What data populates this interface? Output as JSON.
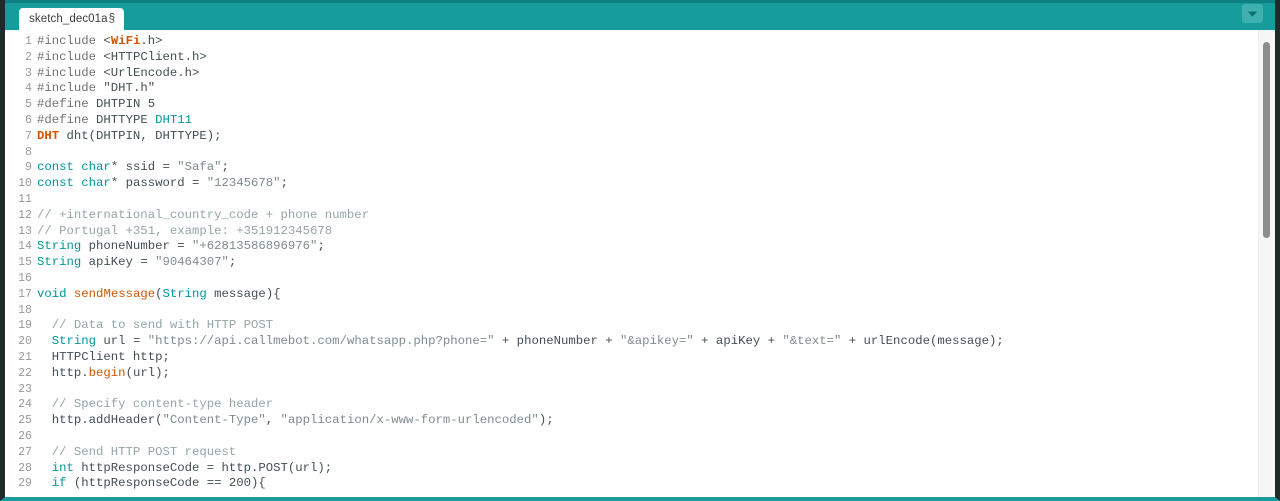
{
  "window": {
    "frame_color": "#1f2b2b",
    "accent_color": "#179c9c"
  },
  "tab_bar": {
    "tabs": [
      {
        "label": "sketch_dec01a",
        "modified_marker": "§",
        "active": true
      }
    ],
    "dropdown_icon": "chevron-down-icon"
  },
  "editor": {
    "language": "arduino-cpp",
    "scrollbar": {
      "orientation": "vertical",
      "thumb_top_pct": 2.5,
      "thumb_height_pct": 42
    },
    "lines": [
      {
        "no": "1",
        "tokens": [
          {
            "t": "#include ",
            "c": "t-pre"
          },
          {
            "t": "<",
            "c": "t-plain"
          },
          {
            "t": "WiFi",
            "c": "t-lib"
          },
          {
            "t": ".h>",
            "c": "t-plain"
          }
        ]
      },
      {
        "no": "2",
        "tokens": [
          {
            "t": "#include ",
            "c": "t-pre"
          },
          {
            "t": "<HTTPClient.h>",
            "c": "t-plain"
          }
        ]
      },
      {
        "no": "3",
        "tokens": [
          {
            "t": "#include ",
            "c": "t-pre"
          },
          {
            "t": "<UrlEncode.h>",
            "c": "t-plain"
          }
        ]
      },
      {
        "no": "4",
        "tokens": [
          {
            "t": "#include ",
            "c": "t-pre"
          },
          {
            "t": "\"DHT.h\"",
            "c": "t-plain"
          }
        ]
      },
      {
        "no": "5",
        "tokens": [
          {
            "t": "#define ",
            "c": "t-pre"
          },
          {
            "t": "DHTPIN 5",
            "c": "t-plain"
          }
        ]
      },
      {
        "no": "6",
        "tokens": [
          {
            "t": "#define ",
            "c": "t-pre"
          },
          {
            "t": "DHTTYPE ",
            "c": "t-plain"
          },
          {
            "t": "DHT11",
            "c": "t-const"
          }
        ]
      },
      {
        "no": "7",
        "tokens": [
          {
            "t": "DHT",
            "c": "t-lib"
          },
          {
            "t": " dht(DHTPIN, DHTTYPE);",
            "c": "t-plain"
          }
        ]
      },
      {
        "no": "8",
        "tokens": []
      },
      {
        "no": "9",
        "tokens": [
          {
            "t": "const",
            "c": "t-kw"
          },
          {
            "t": " ",
            "c": "t-plain"
          },
          {
            "t": "char",
            "c": "t-kw"
          },
          {
            "t": "* ssid = ",
            "c": "t-plain"
          },
          {
            "t": "\"Safa\"",
            "c": "t-str"
          },
          {
            "t": ";",
            "c": "t-plain"
          }
        ]
      },
      {
        "no": "10",
        "tokens": [
          {
            "t": "const",
            "c": "t-kw"
          },
          {
            "t": " ",
            "c": "t-plain"
          },
          {
            "t": "char",
            "c": "t-kw"
          },
          {
            "t": "* password = ",
            "c": "t-plain"
          },
          {
            "t": "\"12345678\"",
            "c": "t-str"
          },
          {
            "t": ";",
            "c": "t-plain"
          }
        ]
      },
      {
        "no": "11",
        "tokens": []
      },
      {
        "no": "12",
        "tokens": [
          {
            "t": "// +international_country_code + phone number",
            "c": "t-cmt"
          }
        ]
      },
      {
        "no": "13",
        "tokens": [
          {
            "t": "// Portugal +351, example: +351912345678",
            "c": "t-cmt"
          }
        ]
      },
      {
        "no": "14",
        "tokens": [
          {
            "t": "String",
            "c": "t-kw"
          },
          {
            "t": " phoneNumber = ",
            "c": "t-plain"
          },
          {
            "t": "\"+62813586896976\"",
            "c": "t-str"
          },
          {
            "t": ";",
            "c": "t-plain"
          }
        ]
      },
      {
        "no": "15",
        "tokens": [
          {
            "t": "String",
            "c": "t-kw"
          },
          {
            "t": " apiKey = ",
            "c": "t-plain"
          },
          {
            "t": "\"90464307\"",
            "c": "t-str"
          },
          {
            "t": ";",
            "c": "t-plain"
          }
        ]
      },
      {
        "no": "16",
        "tokens": []
      },
      {
        "no": "17",
        "tokens": [
          {
            "t": "void",
            "c": "t-kw"
          },
          {
            "t": " ",
            "c": "t-plain"
          },
          {
            "t": "sendMessage",
            "c": "t-func"
          },
          {
            "t": "(",
            "c": "t-plain"
          },
          {
            "t": "String",
            "c": "t-kw"
          },
          {
            "t": " message){",
            "c": "t-plain"
          }
        ]
      },
      {
        "no": "18",
        "tokens": []
      },
      {
        "no": "19",
        "tokens": [
          {
            "t": "  // Data to send with HTTP POST",
            "c": "t-cmt"
          }
        ]
      },
      {
        "no": "20",
        "tokens": [
          {
            "t": "  ",
            "c": "t-plain"
          },
          {
            "t": "String",
            "c": "t-kw"
          },
          {
            "t": " url = ",
            "c": "t-plain"
          },
          {
            "t": "\"https://api.callmebot.com/whatsapp.php?phone=\"",
            "c": "t-str"
          },
          {
            "t": " + phoneNumber + ",
            "c": "t-plain"
          },
          {
            "t": "\"&apikey=\"",
            "c": "t-str"
          },
          {
            "t": " + apiKey + ",
            "c": "t-plain"
          },
          {
            "t": "\"&text=\"",
            "c": "t-str"
          },
          {
            "t": " + urlEncode(message);",
            "c": "t-plain"
          }
        ]
      },
      {
        "no": "21",
        "tokens": [
          {
            "t": "  HTTPClient http;",
            "c": "t-plain"
          }
        ]
      },
      {
        "no": "22",
        "tokens": [
          {
            "t": "  http.",
            "c": "t-plain"
          },
          {
            "t": "begin",
            "c": "t-func"
          },
          {
            "t": "(url);",
            "c": "t-plain"
          }
        ]
      },
      {
        "no": "23",
        "tokens": []
      },
      {
        "no": "24",
        "tokens": [
          {
            "t": "  // Specify content-type header",
            "c": "t-cmt"
          }
        ]
      },
      {
        "no": "25",
        "tokens": [
          {
            "t": "  http.addHeader(",
            "c": "t-plain"
          },
          {
            "t": "\"Content-Type\"",
            "c": "t-str"
          },
          {
            "t": ", ",
            "c": "t-plain"
          },
          {
            "t": "\"application/x-www-form-urlencoded\"",
            "c": "t-str"
          },
          {
            "t": ");",
            "c": "t-plain"
          }
        ]
      },
      {
        "no": "26",
        "tokens": []
      },
      {
        "no": "27",
        "tokens": [
          {
            "t": "  // Send HTTP POST request",
            "c": "t-cmt"
          }
        ]
      },
      {
        "no": "28",
        "tokens": [
          {
            "t": "  ",
            "c": "t-plain"
          },
          {
            "t": "int",
            "c": "t-kw"
          },
          {
            "t": " httpResponseCode = http.POST(url);",
            "c": "t-plain"
          }
        ]
      },
      {
        "no": "29",
        "tokens": [
          {
            "t": "  ",
            "c": "t-plain"
          },
          {
            "t": "if",
            "c": "t-kw"
          },
          {
            "t": " (httpResponseCode == 200){",
            "c": "t-plain"
          }
        ]
      }
    ]
  }
}
